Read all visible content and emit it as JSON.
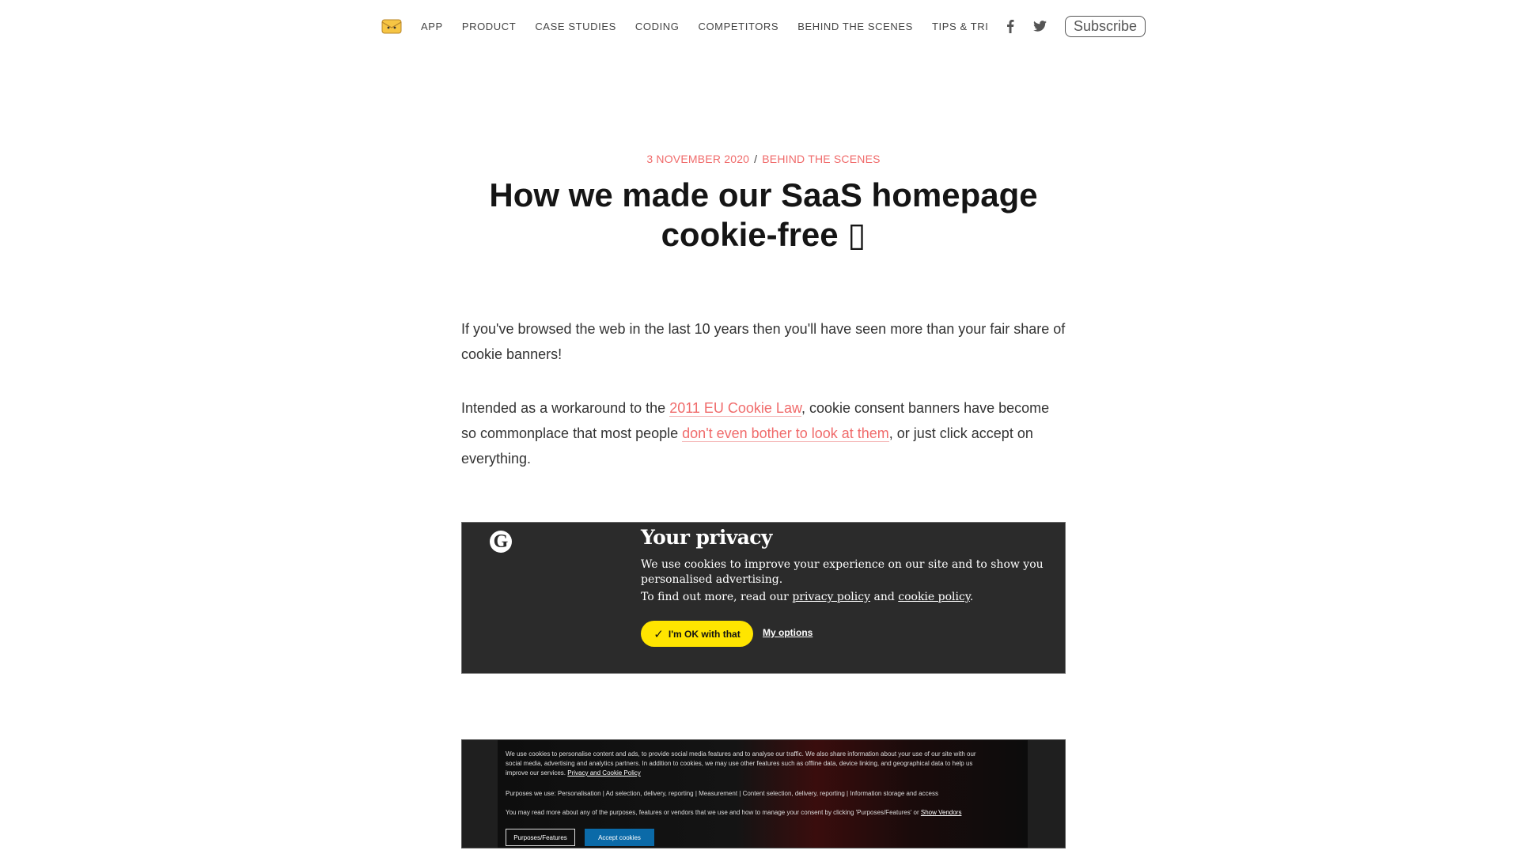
{
  "nav": {
    "items": [
      "APP",
      "PRODUCT",
      "CASE STUDIES",
      "CODING",
      "COMPETITORS",
      "BEHIND THE SCENES",
      "TIPS & TRICKS"
    ],
    "subscribe": "Subscribe",
    "social_icons": [
      "facebook-icon",
      "twitter-icon"
    ]
  },
  "post": {
    "date": "3 NOVEMBER 2020",
    "separator": "/",
    "category": "BEHIND THE SCENES",
    "title": "How we made our SaaS homepage cookie-free ▯"
  },
  "article": {
    "p1": "If you've browsed the web in the last 10 years then you'll have seen more than your fair share of cookie banners!",
    "p2_before": "Intended as a workaround to the ",
    "p2_link1": "2011 EU Cookie Law",
    "p2_middle": ", cookie consent banners have become so commonplace that most people ",
    "p2_link2": "don't even bother to look at them",
    "p2_after": ", or just click accept on everything."
  },
  "image1": {
    "logo": "G",
    "title": "Your privacy",
    "text": "We use cookies to improve your experience on our site and to show you personalised advertising.",
    "text2_before": "To find out more, read our ",
    "privacy_link": "privacy policy",
    "and": " and ",
    "cookie_link": "cookie policy",
    "period": ".",
    "ok_button": "I'm OK with that",
    "options_link": "My options"
  },
  "image2": {
    "text1": "We use cookies to personalise content and ads, to provide social media features and to analyse our traffic. We also share information about your use of our site with our social media, advertising and analytics partners. In addition to cookies, we may use other features such as offline data, device linking, and geographical data to help us improve our services.",
    "text1_link": "Privacy and Cookie Policy",
    "text2": "Purposes we use: Personalisation | Ad selection, delivery, reporting | Measurement | Content selection, delivery, reporting | Information storage and access",
    "text3": "You may read more about any of the purposes, features or vendors that we use and how to manage your consent by clicking 'Purposes/Features' or",
    "text3_link": "Show Vendors",
    "button_purposes": "Purposes/Features",
    "button_accept": "Accept cookies"
  },
  "colors": {
    "accent": "#f06b6b",
    "banner_bg": "#2b2b2b",
    "ok_yellow": "#ffe500",
    "accept_blue": "#0b6aa8"
  }
}
